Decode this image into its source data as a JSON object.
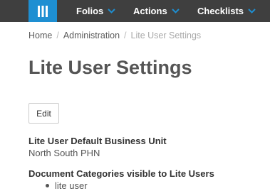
{
  "nav": {
    "items": [
      {
        "label": "Folios"
      },
      {
        "label": "Actions"
      },
      {
        "label": "Checklists"
      }
    ],
    "logo_icon": "grid-bars-icon",
    "colors": {
      "topbar": "#3f3f3f",
      "logo": "#1e8fd2",
      "chevron": "#1e8fd2"
    }
  },
  "breadcrumb": {
    "items": [
      "Home",
      "Administration",
      "Lite User Settings"
    ],
    "separator": "/"
  },
  "page": {
    "title": "Lite User Settings",
    "edit_label": "Edit"
  },
  "fields": {
    "business_unit": {
      "label": "Lite User Default Business Unit",
      "value": "North South PHN"
    },
    "doc_categories": {
      "label": "Document Categories visible to Lite Users",
      "items": [
        "lite user"
      ]
    }
  }
}
